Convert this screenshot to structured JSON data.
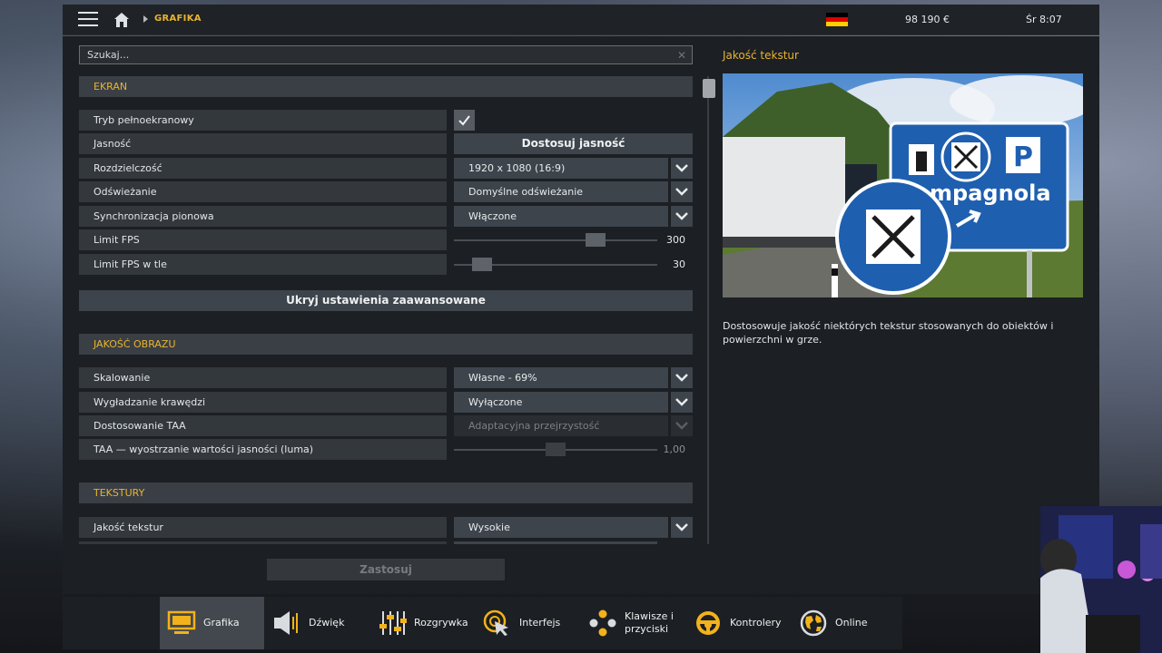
{
  "topbar": {
    "breadcrumb": "GRAFIKA",
    "money": "98 190 €",
    "clock": "Śr 8:07"
  },
  "search": {
    "placeholder": "Szukaj..."
  },
  "sections": {
    "screen": "EKRAN",
    "image_quality": "JAKOŚĆ OBRAZU",
    "textures": "TEKSTURY"
  },
  "screen": {
    "fullscreen": {
      "label": "Tryb pełnoekranowy",
      "checked": true
    },
    "brightness": {
      "label": "Jasność",
      "button": "Dostosuj jasność"
    },
    "resolution": {
      "label": "Rozdzielczość",
      "value": "1920 x 1080 (16:9)"
    },
    "refresh": {
      "label": "Odświeżanie",
      "value": "Domyślne odświeżanie"
    },
    "vsync": {
      "label": "Synchronizacja pionowa",
      "value": "Włączone"
    },
    "fps_limit": {
      "label": "Limit FPS",
      "value": "300",
      "level": 0.72
    },
    "fps_bg": {
      "label": "Limit FPS w tle",
      "value": "30",
      "level": 0.1
    }
  },
  "advanced_button": "Ukryj ustawienia zaawansowane",
  "image_quality": {
    "scaling": {
      "label": "Skalowanie",
      "value": "Własne - 69%"
    },
    "aa": {
      "label": "Wygładzanie krawędzi",
      "value": "Wyłączone"
    },
    "taa": {
      "label": "Dostosowanie TAA",
      "value": "Adaptacyjna przejrzystość"
    },
    "taa_sharpen": {
      "label": "TAA — wyostrzanie wartości jasności (luma)",
      "value": "1,00",
      "level": 0.5
    }
  },
  "textures": {
    "quality": {
      "label": "Jakość tekstur",
      "value": "Wysokie"
    }
  },
  "apply_button": "Zastosuj",
  "info": {
    "title": "Jakość tekstur",
    "sign_text": "mpagnola",
    "description": "Dostosowuje jakość niektórych tekstur stosowanych do obiektów i powierzchni w grze."
  },
  "nav": [
    {
      "label": "Grafika",
      "icon": "monitor-icon",
      "active": true
    },
    {
      "label": "Dźwięk",
      "icon": "speaker-icon"
    },
    {
      "label": "Rozgrywka",
      "icon": "sliders-icon"
    },
    {
      "label": "Interfejs",
      "icon": "cursor-icon"
    },
    {
      "label": "Klawisze i przyciski",
      "icon": "gamepad-buttons-icon"
    },
    {
      "label": "Kontrolery",
      "icon": "steering-wheel-icon"
    },
    {
      "label": "Online",
      "icon": "globe-icon"
    }
  ],
  "colors": {
    "accent": "#e8b430",
    "panel": "#1c1f23",
    "control": "#3d444c"
  }
}
